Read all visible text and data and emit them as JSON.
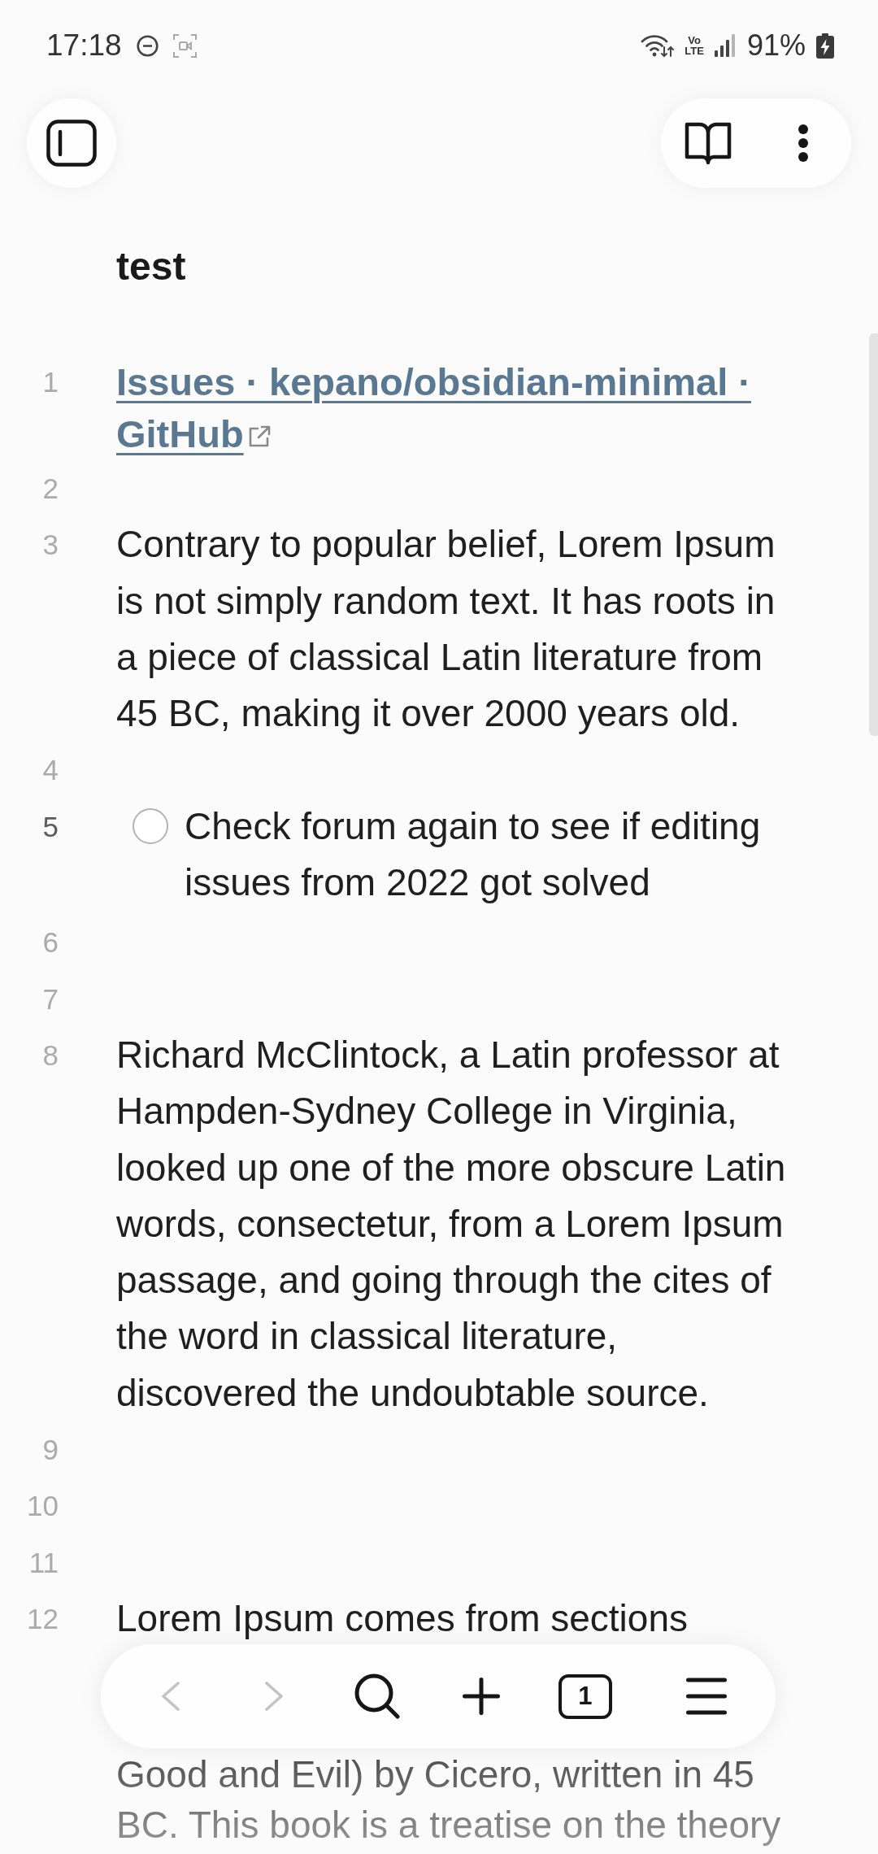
{
  "status_bar": {
    "time": "17:18",
    "network_type": [
      "Vo",
      "LTE"
    ],
    "battery_percent": "91%",
    "charging": true
  },
  "note": {
    "title": "test",
    "lines": [
      {
        "number": "1",
        "kind": "link",
        "text": "Issues · kepano/obsidian-minimal · GitHub",
        "external": true,
        "active": false
      },
      {
        "number": "2",
        "kind": "empty",
        "active": false
      },
      {
        "number": "3",
        "kind": "text",
        "text": "Contrary to popular belief, Lorem Ipsum is not simply random text. It has roots in a piece of classical Latin literature from 45 BC, making it over 2000 years old.",
        "active": false
      },
      {
        "number": "4",
        "kind": "empty",
        "active": false
      },
      {
        "number": "5",
        "kind": "task",
        "text": "Check forum again to see if editing issues from 2022 got solved",
        "checked": false,
        "active": true
      },
      {
        "number": "6",
        "kind": "empty",
        "active": false
      },
      {
        "number": "7",
        "kind": "empty",
        "active": false
      },
      {
        "number": "8",
        "kind": "text",
        "text": "Richard McClintock, a Latin professor at Hampden-Sydney College in Virginia, looked up one of the more obscure Latin words, consectetur, from a Lorem Ipsum passage, and going through the cites of the word in classical literature, discovered the undoubtable source.",
        "active": false
      },
      {
        "number": "9",
        "kind": "empty",
        "active": false
      },
      {
        "number": "10",
        "kind": "empty",
        "active": false
      },
      {
        "number": "11",
        "kind": "empty",
        "active": false
      },
      {
        "number": "12",
        "kind": "text",
        "text": "Lorem Ipsum comes from sections",
        "text_below_toolbar": [
          "Good and Evil) by Cicero, written in 45",
          "BC. This book is a treatise on the theory"
        ],
        "active": false
      }
    ]
  },
  "bottom_toolbar": {
    "back_disabled": true,
    "forward_disabled": true,
    "tab_count": "1"
  }
}
